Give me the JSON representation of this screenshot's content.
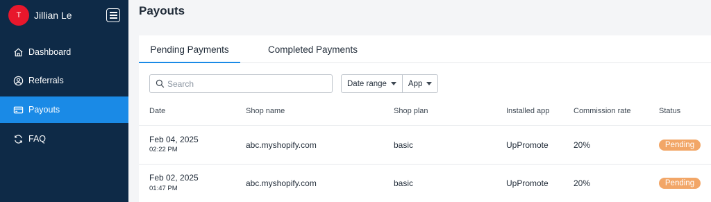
{
  "user": {
    "initial": "T",
    "name": "Jillian Le"
  },
  "sidebar": {
    "items": [
      {
        "label": "Dashboard",
        "icon": "home-icon"
      },
      {
        "label": "Referrals",
        "icon": "user-circle-icon"
      },
      {
        "label": "Payouts",
        "icon": "credit-card-icon",
        "active": true
      },
      {
        "label": "FAQ",
        "icon": "refresh-icon"
      }
    ]
  },
  "page": {
    "title": "Payouts"
  },
  "tabs": [
    {
      "label": "Pending Payments",
      "active": true
    },
    {
      "label": "Completed Payments",
      "active": false
    }
  ],
  "search": {
    "placeholder": "Search",
    "value": ""
  },
  "filters": {
    "date_range": "Date range",
    "app": "App"
  },
  "table": {
    "columns": [
      "Date",
      "Shop name",
      "Shop plan",
      "Installed app",
      "Commission rate",
      "Status"
    ],
    "rows": [
      {
        "date": "Feb 04, 2025",
        "time": "02:22 PM",
        "shop": "abc.myshopify.com",
        "plan": "basic",
        "app": "UpPromote",
        "rate": "20%",
        "status": "Pending"
      },
      {
        "date": "Feb 02, 2025",
        "time": "01:47 PM",
        "shop": "abc.myshopify.com",
        "plan": "basic",
        "app": "UpPromote",
        "rate": "20%",
        "status": "Pending"
      }
    ]
  },
  "colors": {
    "sidebar_bg": "#0e2a47",
    "accent": "#1a8ae6",
    "avatar": "#e8172c",
    "pending_badge": "#f2a667"
  }
}
